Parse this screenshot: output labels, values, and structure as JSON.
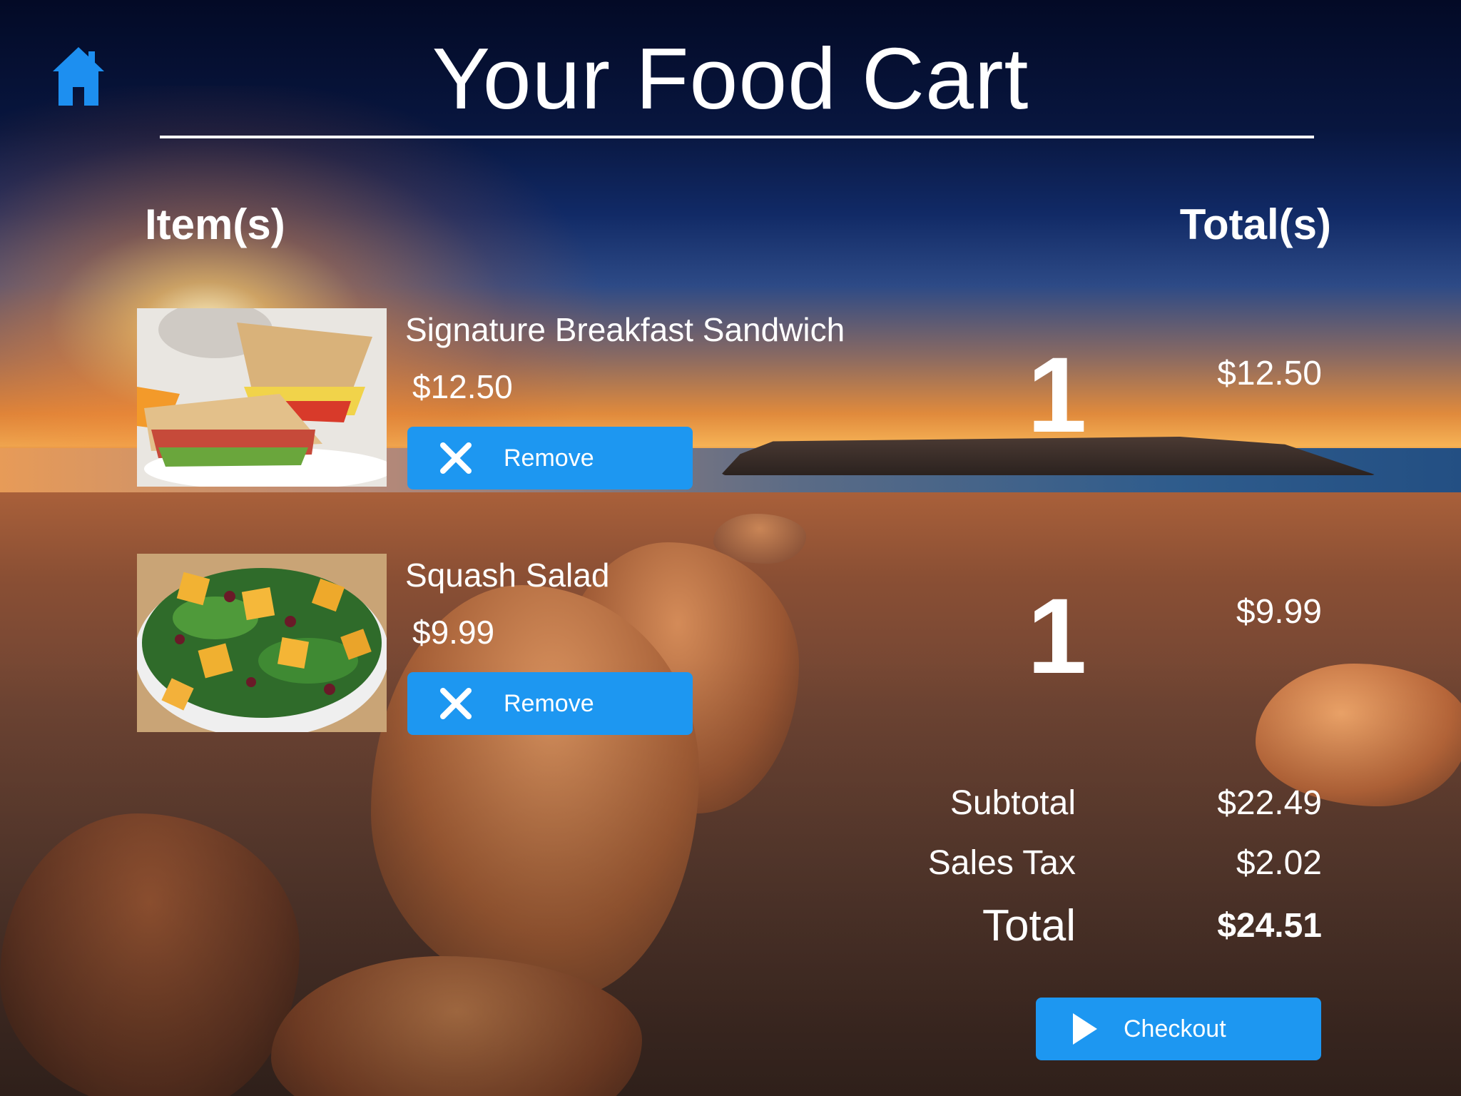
{
  "header": {
    "title": "Your Food Cart",
    "home_icon": "home-icon"
  },
  "columns": {
    "items": "Item(s)",
    "totals": "Total(s)"
  },
  "cart": [
    {
      "name": "Signature Breakfast Sandwich",
      "price": "$12.50",
      "quantity": "1",
      "line_total": "$12.50",
      "remove_label": "Remove",
      "image": "breakfast-sandwich"
    },
    {
      "name": "Squash Salad",
      "price": "$9.99",
      "quantity": "1",
      "line_total": "$9.99",
      "remove_label": "Remove",
      "image": "squash-salad"
    }
  ],
  "summary": {
    "subtotal_label": "Subtotal",
    "subtotal": "$22.49",
    "tax_label": "Sales Tax",
    "tax": "$2.02",
    "total_label": "Total",
    "total": "$24.51"
  },
  "checkout": {
    "label": "Checkout"
  },
  "colors": {
    "accent": "#1d97f1",
    "text": "#ffffff",
    "home_icon": "#1d8ff0"
  }
}
